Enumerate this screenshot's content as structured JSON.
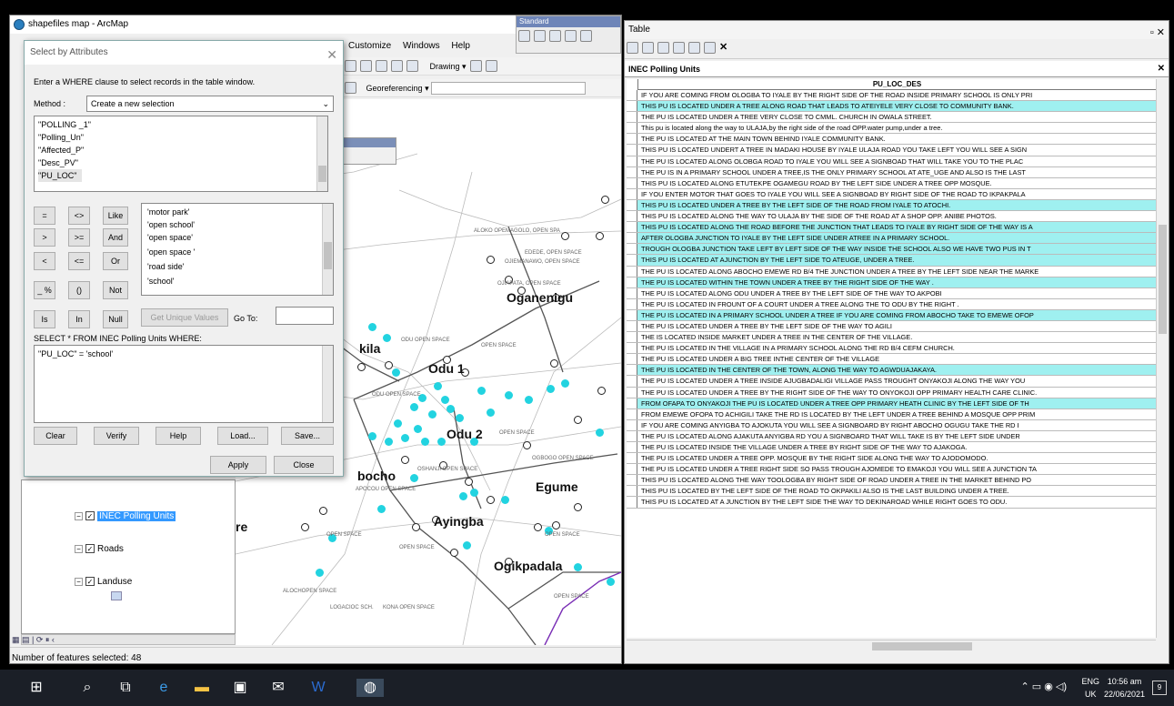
{
  "arcmap": {
    "title": "shapefiles map - ArcMap",
    "menu": [
      "Customize",
      "Windows",
      "Help"
    ],
    "standard_toolbar": "Standard",
    "drawing": "Drawing",
    "georeferencing": "Georeferencing"
  },
  "dialog": {
    "title": "Select by Attributes",
    "instruction": "Enter a WHERE clause to select records in the table window.",
    "method_label": "Method :",
    "method_value": "Create a new selection",
    "fields": [
      "\"POLLING _1\"",
      "\"Polling_Un\"",
      "\"Affected_P\"",
      "\"Desc_PV\"",
      "\"PU_LOC\""
    ],
    "ops": [
      "=",
      "<>",
      "Like",
      ">",
      ">=",
      "And",
      "<",
      "<=",
      "Or",
      "_ %",
      "()",
      "Not",
      "Is",
      "In",
      "Null"
    ],
    "values": [
      "'motor park'",
      "'open school'",
      "'open space'",
      "'open space '",
      "'road side'",
      "'school'"
    ],
    "get_unique": "Get Unique Values",
    "goto_label": "Go To:",
    "select_label": "SELECT * FROM INEC Polling Units WHERE:",
    "expression": "\"PU_LOC\" = 'school'",
    "buttons": {
      "clear": "Clear",
      "verify": "Verify",
      "help": "Help",
      "load": "Load...",
      "save": "Save...",
      "apply": "Apply",
      "close": "Close"
    }
  },
  "toc": {
    "layers": [
      {
        "name": "INEC Polling Units",
        "checked": true
      },
      {
        "name": "Roads",
        "checked": true
      },
      {
        "name": "Landuse",
        "checked": true
      }
    ]
  },
  "map": {
    "labels": [
      "Oganenigu",
      "Odu 1",
      "Odu 2",
      "Egume",
      "Ayingba",
      "Ogikpadala",
      "bocho",
      "kila",
      "re"
    ],
    "small": [
      "ALOKO OPEMAGOLO, OPEN SPA",
      "EDEDE, OPEN SPACE",
      "OJIEMANAWO, OPEN SPACE",
      "OJIAPATA, OPEN SPACE",
      "ODU OPEN SPACE",
      "OPEN SPACE",
      "ODU OPEN SPACE",
      "OPEN SPACE",
      "OSHANJI OPEN SPACE",
      "OGBOGO OPEN SPACE",
      "APOCOU OPEN SPACE",
      "OPEN SPACE",
      "OPEN SPACE",
      "OPEN SPACE",
      "LOGACIOC SCH.",
      "KONA OPEN SPACE",
      "OPEN SPACE",
      "ALOCHOPEN SPACE"
    ],
    "accent_point": "#22d3e0"
  },
  "status": "Number of features selected: 48",
  "table": {
    "title": "Table",
    "tab": "INEC Polling Units",
    "column": "PU_LOC_DES",
    "rows": [
      {
        "t": "IF YOU ARE COMING FROM OLOGBA TO IYALE BY THE  RIGHT SIDE OF THE ROAD INSIDE  PRIMARY SCHOOL IS ONLY PRI",
        "h": false
      },
      {
        "t": "THIS PU IS LOCATED UNDER A TREE ALONG ROAD THAT LEADS TO ATEIYELE VERY CLOSE TO COMMUNITY BANK.",
        "h": true
      },
      {
        "t": "THE PU IS LOCATED UNDER A TREE VERY CLOSE TO CMML. CHURCH IN OWALA STREET.",
        "h": false
      },
      {
        "t": "This pu is located along the way to ULAJA,by the right side of the road OPP.water  pump,under a tree.",
        "h": false
      },
      {
        "t": "THE PU IS LOCATED AT THE MAIN TOWN BEHIND IYALE COMMUNITY BANK.",
        "h": false
      },
      {
        "t": "THIS PU IS LOCATED UNDERT A TREE  IN MADAKI HOUSE BY IYALE ULAJA ROAD YOU TAKE LEFT YOU WILL SEE A SIGN",
        "h": false
      },
      {
        "t": "THE PU IS LOCATED ALONG OLOBGA ROAD TO IYALE YOU WILL SEE A SIGNBOAD THAT WILL TAKE YOU TO THE PLAC",
        "h": false
      },
      {
        "t": "THE PU IS IN A PRIMARY SCHOOL UNDER A TREE,IS THE ONLY PRIMARY SCHOOL AT ATE_UGE AND ALSO IS THE LAST",
        "h": false
      },
      {
        "t": "THIS PU IS LOCATED ALONG ETUTEKPE OGAMEGU ROAD BY THE LEFT SIDE UNDER A TREE OPP MOSQUE.",
        "h": false
      },
      {
        "t": "IF YOU ENTER MOTOR THAT GOES TO IYALE YOU WILL SEE A SIGNBOAD BY RIGHT SIDE OF THE ROAD TO IKPAKPALA",
        "h": false
      },
      {
        "t": "THIS PU  IS LOCATED UNDER A TREE BY THE LEFT SIDE OF THE ROAD FROM IYALE TO ATOCHI.",
        "h": true
      },
      {
        "t": "THIS PU IS LOCATED ALONG THE WAY TO ULAJA BY THE SIDE OF THE ROAD AT  A SHOP OPP. ANIBE PHOTOS.",
        "h": false
      },
      {
        "t": "THIS PU IS LOCATED ALONG THE ROAD BEFORE THE JUNCTION THAT LEADS TO IYALE BY RIGHT SIDE OF THE WAY IS A",
        "h": true
      },
      {
        "t": "AFTER OLOGBA JUNCTION TO IYALE BY THE LEFT SIDE  UNDER ATREE IN A PRIMARY SCHOOL.",
        "h": true
      },
      {
        "t": "TROUGH OLOGBA JUNCTION TAKE LEFT BY LEFT SIDE OF THE WAY INSIDE THE SCHOOL ALSO WE HAVE TWO PUS IN  T",
        "h": true
      },
      {
        "t": "THIS PU IS LOCATED AT AJUNCTION BY THE LEFT SIDE TO ATEUGE, UNDER A TREE.",
        "h": true
      },
      {
        "t": "THE PU IS LOCATED ALONG ABOCHO EMEWE RD B/4 THE JUNCTION UNDER A TREE BY THE LEFT SIDE NEAR THE MARKE",
        "h": false
      },
      {
        "t": "THE PU IS LOCATED WITHIN THE TOWN UNDER A TREE BY THE RIGHT SIDE  OF THE WAY .",
        "h": true
      },
      {
        "t": "THE PU IS LOCATED ALONG ODU UNDER A TREE BY THE LEFT SIDE OF THE WAY TO AKPOBI",
        "h": false
      },
      {
        "t": "THE PU IS LOCATED IN FROUNT OF A COURT UNDER A TREE  ALONG THE TO ODU BY THE RIGHT .",
        "h": false
      },
      {
        "t": "THE PU IS LOCATED IN A PRIMARY SCHOOL UNDER A TREE IF YOU ARE COMING FROM ABOCHO TAKE TO EMEWE OFOP",
        "h": true
      },
      {
        "t": "THE PU IS LOCATED UNDER A TREE BY THE LEFT SIDE OF THE WAY TO AGILI",
        "h": false
      },
      {
        "t": "THE IS LOCATED INSIDE MARKET UNDER A TREE IN THE CENTER OF THE  VILLAGE.",
        "h": false
      },
      {
        "t": "THE PU IS LOCATED IN THE VILLAGE IN A PRIMARY SCHOOL ALONG THE RD B/4  CEFM CHURCH.",
        "h": false
      },
      {
        "t": "THE PU IS LOCATED UNDER A BIG TREE INTHE CENTER OF THE VILLAGE",
        "h": false
      },
      {
        "t": "THE PU IS LOCATED IN THE CENTER OF THE TOWN, ALONG THE WAY TO AGWDUAJAKAYA.",
        "h": true
      },
      {
        "t": "THE PU IS LOCATED UNDER A TREE INSIDE AJUGBADALIGI VILLAGE PASS TROUGHT ONYAKOJI ALONG THE WAY  YOU",
        "h": false
      },
      {
        "t": "THE PU IS LOCATED UNDER A TREE BY THE RIGHT SIDE OF THE WAY TO ONYOKOJI OPP PRIMARY HEALTH CARE CLINIC.",
        "h": false
      },
      {
        "t": "FROM OFAPA TO ONYAKOJI THE PU IS LOCATED UNDER A TREE  OPP PRIMARY HEATH CLINIC  BY THE LEFT SIDE  OF TH",
        "h": true
      },
      {
        "t": "FROM EMEWE OFOPA TO ACHIGILI TAKE THE RD IS LOCATED BY THE LEFT UNDER A TREE BEHIND A MOSQUE OPP  PRIM",
        "h": false
      },
      {
        "t": "IF YOU ARE COMING ANYIGBA TO AJOKUTA YOU WILL SEE A SIGNBOARD BY RIGHT  ABOCHO OGUGU TAKE THE RD  I",
        "h": false
      },
      {
        "t": "THE PU  IS LOCATED ALONG AJAKUTA ANYIGBA RD YOU A SIGNBOARD THAT WILL TAKE  IS BY THE LEFT SIDE UNDER",
        "h": false
      },
      {
        "t": "THE PU IS LOCATED INSIDE THE VILLAGE UNDER A TREE BY RIGHT  SIDE OF THE WAY TO AJAKOGA.",
        "h": false
      },
      {
        "t": "THE PU IS LOCATED UNDER A TREE OPP. MOSQUE BY THE RIGHT SIDE ALONG THE WAY TO AJODOMODO.",
        "h": false
      },
      {
        "t": "THE PU IS LOCATED UNDER A TREE RIGHT SIDE SO PASS TROUGH AJOMEDE TO EMAKOJI YOU WILL SEE A JUNCTION TA",
        "h": false
      },
      {
        "t": "THIS PU IS LOCATED ALONG THE WAY TOOLOGBA BY RIGHT SIDE OF ROAD  UNDER A TREE  IN THE MARKET BEHIND PO",
        "h": false
      },
      {
        "t": "THIS PU IS LOCATED BY THE LEFT SIDE OF THE ROAD TO OKPAKILI ALSO IS THE LAST BUILDING UNDER A TREE.",
        "h": false
      },
      {
        "t": "THIS PU IS LOCATED AT A JUNCTION BY THE LEFT SIDE THE WAY TO DEKINAROAD WHILE RIGHT GOES TO ODU.",
        "h": false
      }
    ]
  },
  "taskbar": {
    "lang1": "ENG",
    "lang2": "UK",
    "time": "10:56 am",
    "date": "22/06/2021",
    "notif": "9"
  }
}
